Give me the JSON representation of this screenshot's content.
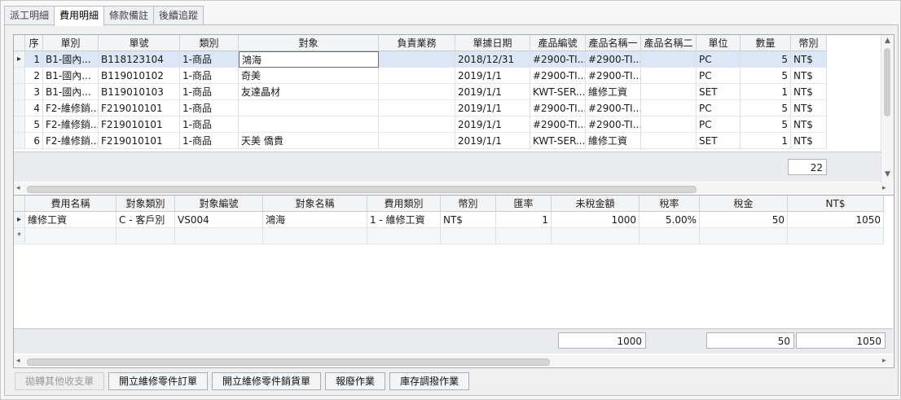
{
  "tabs": [
    "派工明細",
    "費用明細",
    "條款備註",
    "後續追蹤"
  ],
  "top_grid": {
    "columns": [
      "序",
      "單別",
      "單號",
      "類別",
      "對象",
      "負責業務",
      "單據日期",
      "產品編號",
      "產品名稱一",
      "產品名稱二",
      "單位",
      "數量",
      "幣別"
    ],
    "rows": [
      [
        "1",
        "B1-國內...",
        "B118123104",
        "1-商品",
        "鴻海",
        "",
        "2018/12/31",
        "#2900-TI...",
        "#2900-TI...",
        "",
        "PC",
        "5",
        "NT$"
      ],
      [
        "2",
        "B1-國內...",
        "B119010102",
        "1-商品",
        "奇美",
        "",
        "2019/1/1",
        "#2900-TI...",
        "#2900-TI...",
        "",
        "PC",
        "5",
        "NT$"
      ],
      [
        "3",
        "B1-國內...",
        "B119010103",
        "1-商品",
        "友達晶材",
        "",
        "2019/1/1",
        "KWT-SER...",
        "維修工資",
        "",
        "SET",
        "1",
        "NT$"
      ],
      [
        "4",
        "F2-維修銷...",
        "F219010101",
        "1-商品",
        "",
        "",
        "2019/1/1",
        "#2900-TI...",
        "#2900-TI...",
        "",
        "PC",
        "5",
        "NT$"
      ],
      [
        "5",
        "F2-維修銷...",
        "F219010101",
        "1-商品",
        "",
        "",
        "2019/1/1",
        "#2900-TI...",
        "#2900-TI...",
        "",
        "PC",
        "5",
        "NT$"
      ],
      [
        "6",
        "F2-維修銷...",
        "F219010101",
        "1-商品",
        "天美 僑貴",
        "",
        "2019/1/1",
        "KWT-SER...",
        "維修工資",
        "",
        "SET",
        "1",
        "NT$"
      ]
    ],
    "total_quantity": "22"
  },
  "bottom_grid": {
    "columns": [
      "費用名稱",
      "對象類別",
      "對象編號",
      "對象名稱",
      "費用類別",
      "幣別",
      "匯率",
      "未稅金額",
      "稅率",
      "稅金",
      "NT$"
    ],
    "rows": [
      [
        "維修工資",
        "C - 客戶別",
        "VS004",
        "鴻海",
        "1 - 維修工資",
        "NT$",
        "1",
        "1000",
        "5.00%",
        "50",
        "1050"
      ]
    ],
    "totals": {
      "untaxed": "1000",
      "tax": "50",
      "ntd": "1050"
    }
  },
  "buttons": [
    "拋轉其他收支單",
    "開立維修零件訂單",
    "開立維修零件銷貨單",
    "報廢作業",
    "庫存調撥作業"
  ],
  "new_row_marker": "*",
  "current_row_marker": "▸"
}
